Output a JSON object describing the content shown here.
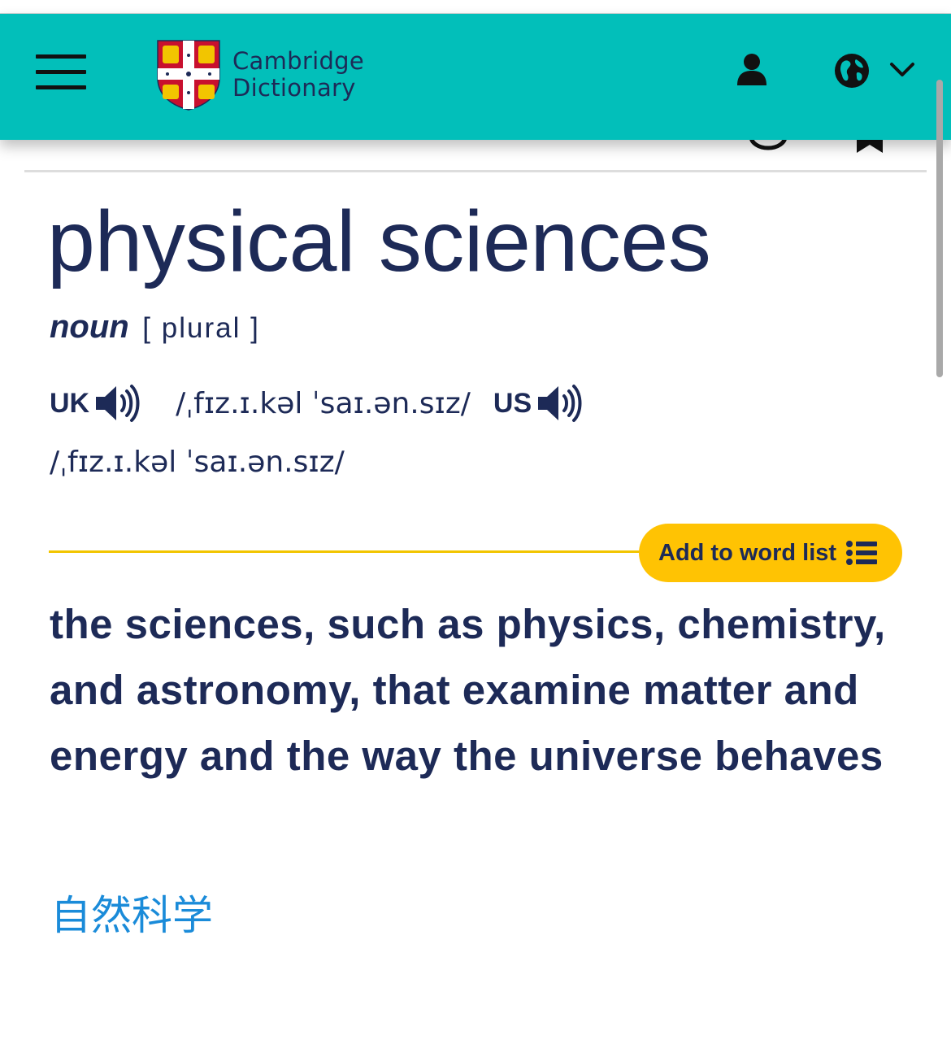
{
  "header": {
    "logo_line1": "Cambridge",
    "logo_line2": "Dictionary",
    "background_color": "#02bfba",
    "icons": [
      "menu-icon",
      "cambridge-shield-logo",
      "user-icon",
      "globe-icon",
      "chevron-down-icon"
    ]
  },
  "entry": {
    "headword": "physical sciences",
    "part_of_speech": "noun",
    "grammar": "[ plural ]",
    "uk_label": "UK",
    "uk_ipa": "/ˌfɪz.ɪ.kəl ˈsaɪ.ən.sɪz/",
    "us_label": "US",
    "us_ipa": "/ˌfɪz.ɪ.kəl ˈsaɪ.ən.sɪz/",
    "add_to_list_label": "Add to word list",
    "definition": "the sciences, such as physics, chemistry, and astronomy, that examine matter and energy and the way the universe behaves",
    "translation": "自然科学"
  },
  "colors": {
    "text": "#1d2a57",
    "accent_yellow": "#ffc303",
    "translation_blue": "#1a8bd9"
  }
}
